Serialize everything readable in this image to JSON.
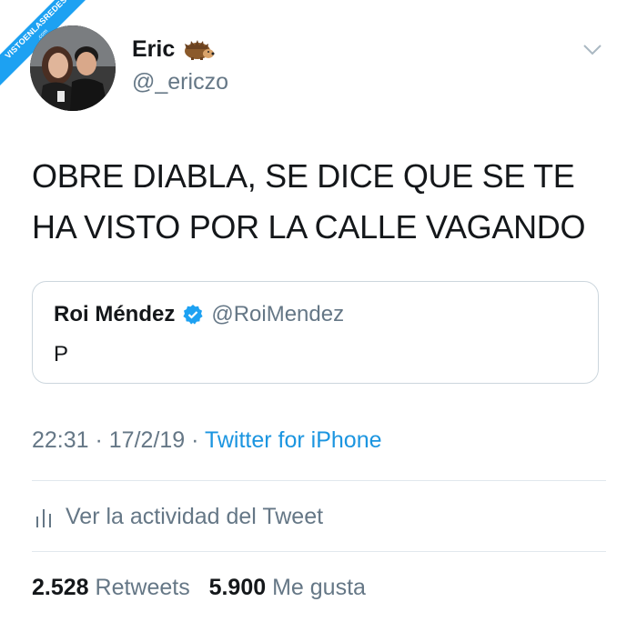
{
  "watermark": {
    "text": "VISTOENLASREDES",
    "sub": ".com"
  },
  "user": {
    "name": "Eric",
    "handle": "@_ericzo"
  },
  "tweet": {
    "line1": "OBRE DIABLA, SE DICE QUE SE TE",
    "line2": "HA VISTO POR LA CALLE VAGANDO"
  },
  "quoted": {
    "name": "Roi Méndez",
    "handle": "@RoiMendez",
    "text": "P"
  },
  "meta": {
    "time": "22:31",
    "sep": " · ",
    "date": "17/2/19",
    "source": "Twitter for iPhone"
  },
  "activity": {
    "label": "Ver la actividad del Tweet"
  },
  "stats": {
    "retweets": "2.528",
    "retweets_label": "Retweets",
    "likes": "5.900",
    "likes_label": "Me gusta"
  },
  "colors": {
    "link": "#1b95e0",
    "secondary": "#657786",
    "verified": "#1da1f2"
  }
}
